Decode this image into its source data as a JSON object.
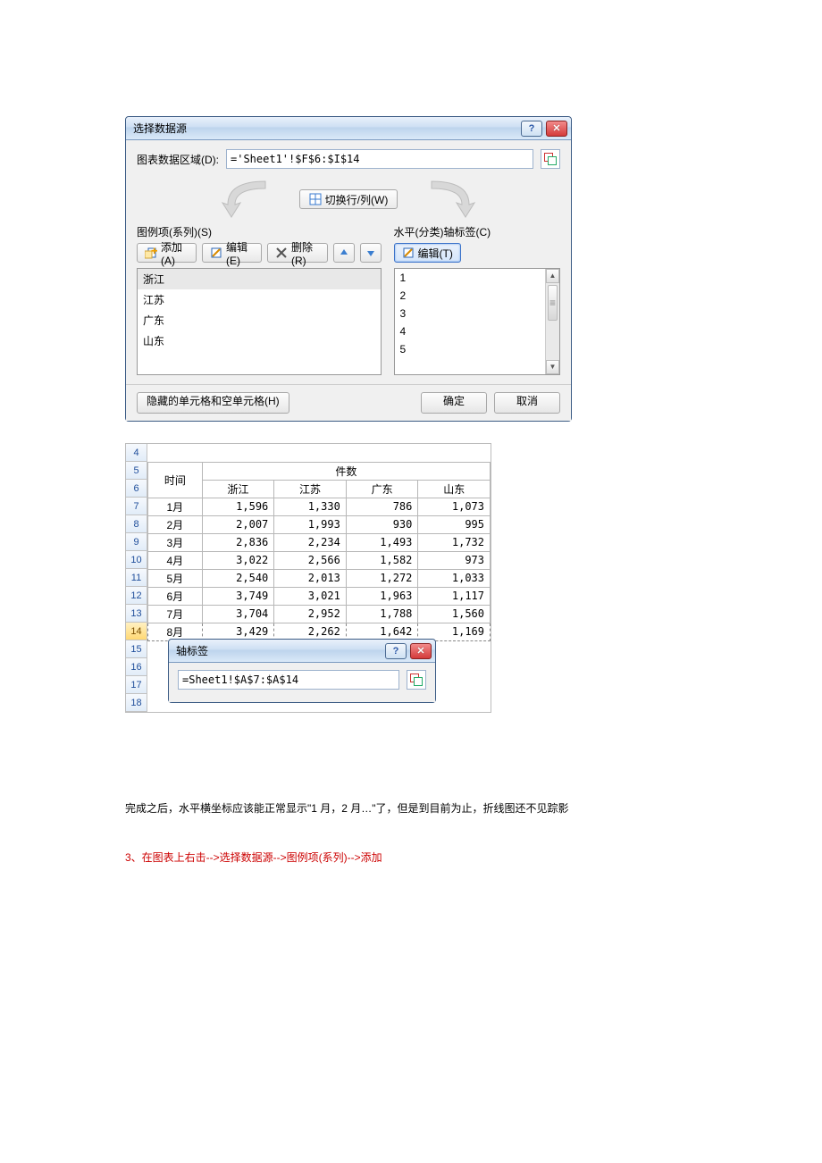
{
  "dlg1": {
    "title": "选择数据源",
    "range_label": "图表数据区域(D):",
    "range_value": "='Sheet1'!$F$6:$I$14",
    "swap_label": "切换行/列(W)",
    "left_heading": "图例项(系列)(S)",
    "right_heading": "水平(分类)轴标签(C)",
    "btn_add": "添加(A)",
    "btn_edit": "编辑(E)",
    "btn_remove": "删除(R)",
    "btn_edit_t": "编辑(T)",
    "series": [
      "浙江",
      "江苏",
      "广东",
      "山东"
    ],
    "axis_labels": [
      "1",
      "2",
      "3",
      "4",
      "5"
    ],
    "btn_hidden": "隐藏的单元格和空单元格(H)",
    "btn_ok": "确定",
    "btn_cancel": "取消"
  },
  "sheet": {
    "row_nums": [
      "4",
      "5",
      "6",
      "7",
      "8",
      "9",
      "10",
      "11",
      "12",
      "13",
      "14",
      "15",
      "16",
      "17",
      "18"
    ],
    "time_header": "时间",
    "count_header": "件数",
    "cols": [
      "浙江",
      "江苏",
      "广东",
      "山东"
    ],
    "rows": [
      {
        "t": "1月",
        "v": [
          "1,596",
          "1,330",
          "786",
          "1,073"
        ]
      },
      {
        "t": "2月",
        "v": [
          "2,007",
          "1,993",
          "930",
          "995"
        ]
      },
      {
        "t": "3月",
        "v": [
          "2,836",
          "2,234",
          "1,493",
          "1,732"
        ]
      },
      {
        "t": "4月",
        "v": [
          "3,022",
          "2,566",
          "1,582",
          "973"
        ]
      },
      {
        "t": "5月",
        "v": [
          "2,540",
          "2,013",
          "1,272",
          "1,033"
        ]
      },
      {
        "t": "6月",
        "v": [
          "3,749",
          "3,021",
          "1,963",
          "1,117"
        ]
      },
      {
        "t": "7月",
        "v": [
          "3,704",
          "2,952",
          "1,788",
          "1,560"
        ]
      },
      {
        "t": "8月",
        "v": [
          "3,429",
          "2,262",
          "1,642",
          "1,169"
        ]
      }
    ]
  },
  "dlg2": {
    "title": "轴标签",
    "value": "=Sheet1!$A$7:$A$14"
  },
  "caption": "完成之后，水平横坐标应该能正常显示\"1 月，2 月…\"了，但是到目前为止，折线图还不见踪影",
  "step3": "3、在图表上右击-->选择数据源-->图例项(系列)-->添加"
}
